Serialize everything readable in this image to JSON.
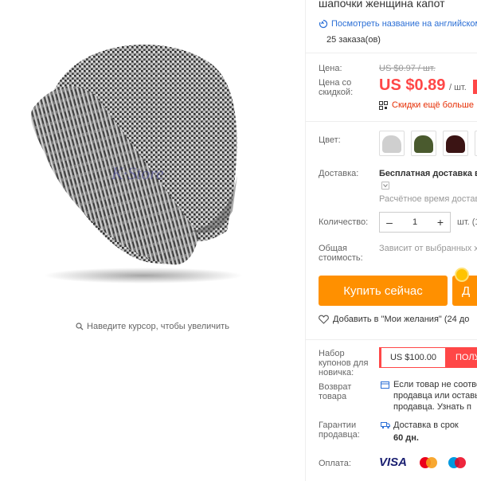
{
  "zoom_hint": "Наведите курсор, чтобы увеличить",
  "product": {
    "title": "шапочки женщина капот",
    "translate_link": "Посмотреть название на английском",
    "orders": "25 заказа(ов)"
  },
  "price": {
    "price_label": "Цена:",
    "old_price": "US $0.97 / шт.",
    "discount_label": "Цена со скидкой:",
    "new_price": "US $0.89",
    "unit": "/ шт.",
    "more_discounts": "Скидки ещё больше"
  },
  "color": {
    "label": "Цвет:",
    "swatches": [
      {
        "name": "light-gray",
        "hat": "#cfcfcf",
        "bg": "#f3f3f3"
      },
      {
        "name": "army-green",
        "hat": "#4a5a2e",
        "bg": "#dfe3d6"
      },
      {
        "name": "burgundy",
        "hat": "#3b1414",
        "bg": "#e2d8d8"
      },
      {
        "name": "gray",
        "hat": "#8a8a8a",
        "bg": "#e9e9e9"
      }
    ]
  },
  "shipping": {
    "label": "Доставка:",
    "value": "Бесплатная доставка в",
    "estimate": "Расчётное время доставки"
  },
  "quantity": {
    "label": "Количество:",
    "value": "1",
    "minus": "–",
    "plus": "+",
    "unit": "шт. (1"
  },
  "total": {
    "label": "Общая стоимость:",
    "note": "Зависит от выбранных х"
  },
  "actions": {
    "buy_now": "Купить сейчас",
    "add_to_cart": "Д",
    "wishlist": "Добавить в \"Мои желания\" (24 до"
  },
  "coupon": {
    "label": "Набор купонов для новичка:",
    "amount": "US $100.00",
    "button": "ПОЛУ"
  },
  "returns": {
    "label": "Возврат товара",
    "line1": "Если товар не соотве",
    "line2": "продавца или оставы",
    "line3": "продавца. Узнать п"
  },
  "guarantee": {
    "label": "Гарантии продавца:",
    "line1": "Доставка в срок",
    "line2": "60 дн."
  },
  "payment": {
    "label": "Оплата:",
    "visa": "VISA"
  },
  "colors": {
    "price_red": "#ff4747",
    "button_orange": "#ff9000",
    "link_blue": "#2b6fd6"
  }
}
